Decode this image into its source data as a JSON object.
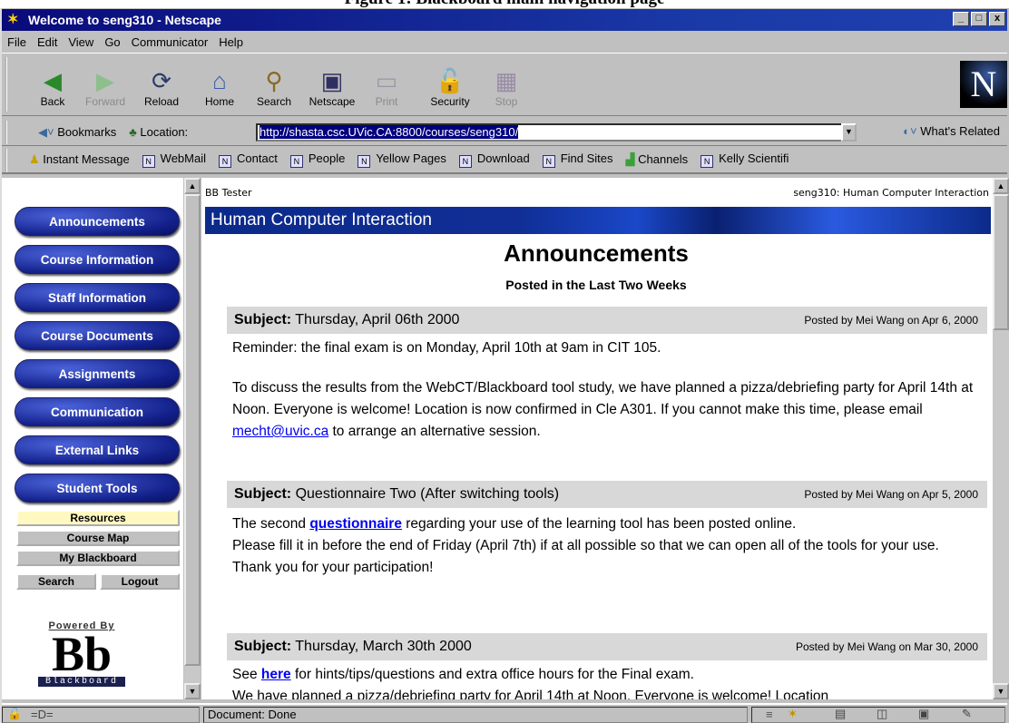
{
  "caption": "Figure 1: Blackboard main navigation page",
  "window": {
    "title": "Welcome to seng310 - Netscape",
    "buttons": [
      "_",
      "□",
      "x"
    ]
  },
  "menu": [
    "File",
    "Edit",
    "View",
    "Go",
    "Communicator",
    "Help"
  ],
  "toolbar": {
    "buttons": [
      {
        "label": "Back",
        "icon": "back-icon",
        "enabled": true
      },
      {
        "label": "Forward",
        "icon": "forward-icon",
        "enabled": false
      },
      {
        "label": "Reload",
        "icon": "reload-icon",
        "enabled": true
      },
      {
        "label": "Home",
        "icon": "home-icon",
        "enabled": true
      },
      {
        "label": "Search",
        "icon": "search-icon",
        "enabled": true
      },
      {
        "label": "Netscape",
        "icon": "netscape-icon",
        "enabled": true
      },
      {
        "label": "Print",
        "icon": "print-icon",
        "enabled": false
      },
      {
        "label": "Security",
        "icon": "lock-icon",
        "enabled": true
      },
      {
        "label": "Stop",
        "icon": "stop-icon",
        "enabled": false
      }
    ],
    "logo": "N"
  },
  "location": {
    "bookmarks": "Bookmarks",
    "label": "Location:",
    "url": "http://shasta.csc.UVic.CA:8800/courses/seng310/",
    "related": "What's Related"
  },
  "personal": [
    "Instant Message",
    "WebMail",
    "Contact",
    "People",
    "Yellow Pages",
    "Download",
    "Find Sites",
    "Channels",
    "Kelly Scientifi"
  ],
  "sidebar": {
    "nav": [
      "Announcements",
      "Course Information",
      "Staff Information",
      "Course Documents",
      "Assignments",
      "Communication",
      "External Links",
      "Student Tools"
    ],
    "resources": "Resources",
    "course_map": "Course Map",
    "my_blackboard": "My Blackboard",
    "search": "Search",
    "logout": "Logout",
    "powered": {
      "label": "Powered By",
      "letters": "Bb",
      "name": "Blackboard"
    }
  },
  "content": {
    "user": "BB Tester",
    "course": "seng310: Human Computer Interaction",
    "banner": "Human Computer Interaction",
    "heading": "Announcements",
    "subheading": "Posted in the Last Two Weeks",
    "subject_label": "Subject:",
    "announcements": [
      {
        "subject": "Thursday, April 06th 2000",
        "posted": "Posted by Mei Wang on Apr 6, 2000",
        "p1": "Reminder: the final exam is on Monday, April 10th at 9am in CIT 105.",
        "p2a": "To discuss the results from the WebCT/Blackboard tool study, we have planned a pizza/debriefing party for April 14th at Noon. Everyone is welcome! Location is now confirmed in Cle A301. If you cannot make this time, please email ",
        "p2link": "mecht@uvic.ca",
        "p2b": " to arrange an alternative session."
      },
      {
        "subject": "Questionnaire Two (After switching tools)",
        "posted": "Posted by Mei Wang on Apr 5, 2000",
        "p1a": "The second ",
        "p1link": "questionnaire",
        "p1b": " regarding your use of the learning tool has been posted online.",
        "p2": "Please fill it in before the end of Friday (April 7th) if at all possible so that we can open all of the tools for your use.",
        "p3": "Thank you for your participation!"
      },
      {
        "subject": "Thursday, March 30th 2000",
        "posted": "Posted by Mei Wang on Mar 30, 2000",
        "p1a": "See ",
        "p1link": "here",
        "p1b": " for hints/tips/questions and extra office hours for the Final exam.",
        "p2": "We have planned a pizza/debriefing party for April 14th at Noon. Everyone is welcome! Location"
      }
    ]
  },
  "status": {
    "text": "Document: Done"
  }
}
